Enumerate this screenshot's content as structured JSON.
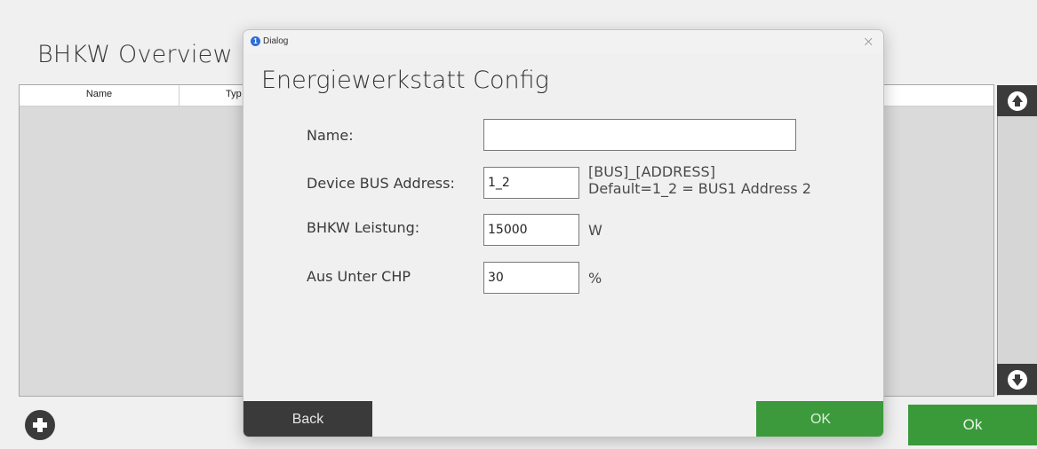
{
  "background": {
    "title": "BHKW Overview",
    "table": {
      "columns": [
        "Name",
        "Typ"
      ]
    },
    "ok_label": "Ok",
    "icons": {
      "add": "plus-circle-icon",
      "scroll_up": "arrow-up-circle-icon",
      "scroll_down": "arrow-down-circle-icon"
    }
  },
  "dialog": {
    "window_title": "Dialog",
    "app_icon_glyph": "1",
    "close_glyph": "×",
    "heading": "Energiewerkstatt Config",
    "fields": [
      {
        "label": "Name:",
        "value": "",
        "hint": ""
      },
      {
        "label": "Device BUS Address:",
        "value": "1_2",
        "hint_line1": "[BUS]_[ADDRESS]",
        "hint_line2": "Default=1_2 = BUS1 Address 2"
      },
      {
        "label": "BHKW Leistung:",
        "value": "15000",
        "hint": "W"
      },
      {
        "label": "Aus Unter CHP",
        "value": "30",
        "hint": "%"
      }
    ],
    "back_label": "Back",
    "ok_label": "OK"
  },
  "colors": {
    "accent_green": "#3c9a3c",
    "dark_button": "#3a3a3a"
  }
}
